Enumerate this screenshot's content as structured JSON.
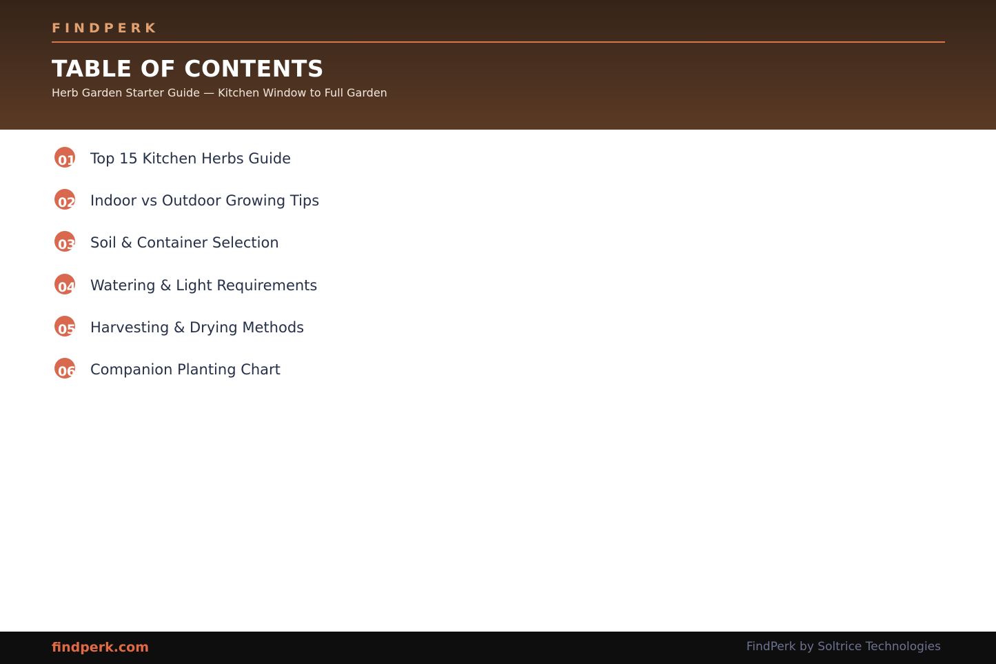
{
  "header": {
    "brand": "FINDPERK",
    "title": "TABLE OF CONTENTS",
    "subtitle": "Herb Garden Starter Guide — Kitchen Window to Full Garden"
  },
  "toc": {
    "items": [
      {
        "number": "01",
        "label": "Top 15 Kitchen Herbs Guide"
      },
      {
        "number": "02",
        "label": "Indoor vs Outdoor Growing Tips"
      },
      {
        "number": "03",
        "label": "Soil & Container Selection"
      },
      {
        "number": "04",
        "label": "Watering & Light Requirements"
      },
      {
        "number": "05",
        "label": "Harvesting & Drying Methods"
      },
      {
        "number": "06",
        "label": "Companion Planting Chart"
      }
    ]
  },
  "footer": {
    "site": "findperk.com",
    "credit": "FindPerk by Soltrice Technologies"
  },
  "colors": {
    "accent": "#d9694e",
    "header_dark": "#342418",
    "text": "#273049"
  }
}
